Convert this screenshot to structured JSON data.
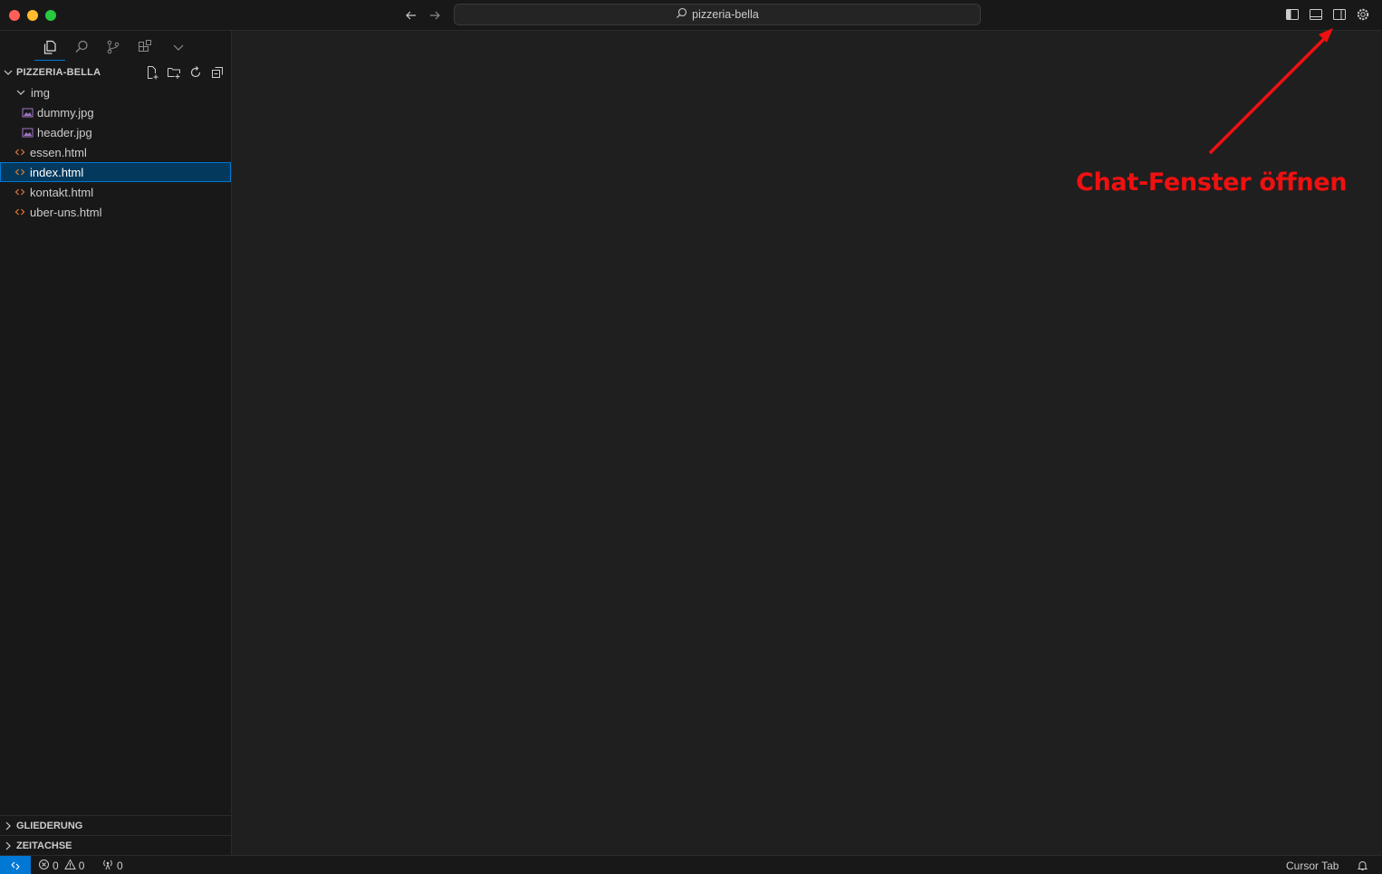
{
  "titlebar": {
    "search_text": "pizzeria-bella"
  },
  "explorer": {
    "title": "PIZZERIA-BELLA",
    "tree": [
      {
        "label": "img",
        "kind": "folder"
      },
      {
        "label": "dummy.jpg",
        "kind": "image"
      },
      {
        "label": "header.jpg",
        "kind": "image"
      },
      {
        "label": "essen.html",
        "kind": "html"
      },
      {
        "label": "index.html",
        "kind": "html",
        "selected": true
      },
      {
        "label": "kontakt.html",
        "kind": "html"
      },
      {
        "label": "uber-uns.html",
        "kind": "html"
      }
    ]
  },
  "sections": {
    "outline": "GLIEDERUNG",
    "timeline": "ZEITACHSE"
  },
  "annotation": {
    "text": "Chat-Fenster öffnen",
    "color": "#f01010"
  },
  "statusbar": {
    "errors": "0",
    "warnings": "0",
    "ports": "0",
    "cursor_tab": "Cursor Tab"
  },
  "colors": {
    "accent": "#0078d4",
    "html_icon": "#e37933",
    "image_icon": "#a074c4"
  }
}
